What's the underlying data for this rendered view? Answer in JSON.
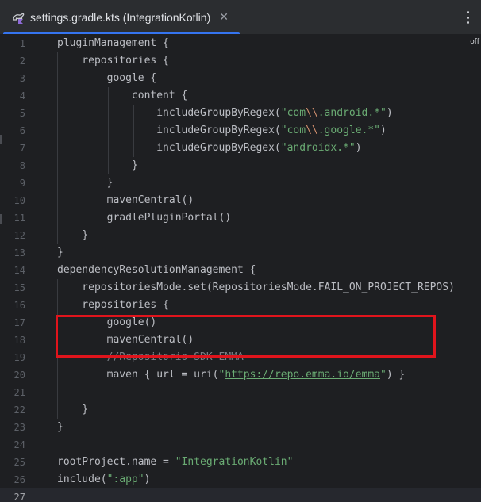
{
  "tab": {
    "title": "settings.gradle.kts (IntegrationKotlin)",
    "close_glyph": "✕",
    "icon": "gradle-kotlin-file-icon",
    "accent_color": "#3574f0"
  },
  "menu": {
    "icon": "more-vertical-icon"
  },
  "editor": {
    "inspection_badge": "off",
    "current_line": 27,
    "highlight_color": "#e0141c",
    "line_numbers": [
      "1",
      "2",
      "3",
      "4",
      "5",
      "6",
      "7",
      "8",
      "9",
      "10",
      "11",
      "12",
      "13",
      "14",
      "15",
      "16",
      "17",
      "18",
      "19",
      "20",
      "21",
      "22",
      "23",
      "24",
      "25",
      "26",
      "27"
    ],
    "lines": {
      "l1": "pluginManagement {",
      "l2": "    repositories {",
      "l3": "        google {",
      "l4": "            content {",
      "l5a": "                includeGroupByRegex(",
      "l5b": "\"com",
      "l5c": "\\\\",
      "l5d": ".android.*\"",
      "l5e": ")",
      "l6a": "                includeGroupByRegex(",
      "l6b": "\"com",
      "l6c": "\\\\",
      "l6d": ".google.*\"",
      "l6e": ")",
      "l7a": "                includeGroupByRegex(",
      "l7b": "\"androidx.*\"",
      "l7c": ")",
      "l8": "            }",
      "l9": "        }",
      "l10": "        mavenCentral()",
      "l11": "        gradlePluginPortal()",
      "l12": "    }",
      "l13": "}",
      "l14": "dependencyResolutionManagement {",
      "l15": "    repositoriesMode.set(RepositoriesMode.FAIL_ON_PROJECT_REPOS)",
      "l16": "    repositories {",
      "l17": "        google()",
      "l18": "        mavenCentral()",
      "l19": "        //Repositorio SDK EMMA",
      "l20a": "        maven { url = uri(",
      "l20b": "\"",
      "l20c": "https://repo.emma.io/emma",
      "l20d": "\"",
      "l20e": ") }",
      "l21": "",
      "l22": "    }",
      "l23": "}",
      "l24": "",
      "l25a": "rootProject.name = ",
      "l25b": "\"IntegrationKotlin\"",
      "l26a": "include(",
      "l26b": "\":app\"",
      "l26c": ")",
      "l27": ""
    }
  }
}
